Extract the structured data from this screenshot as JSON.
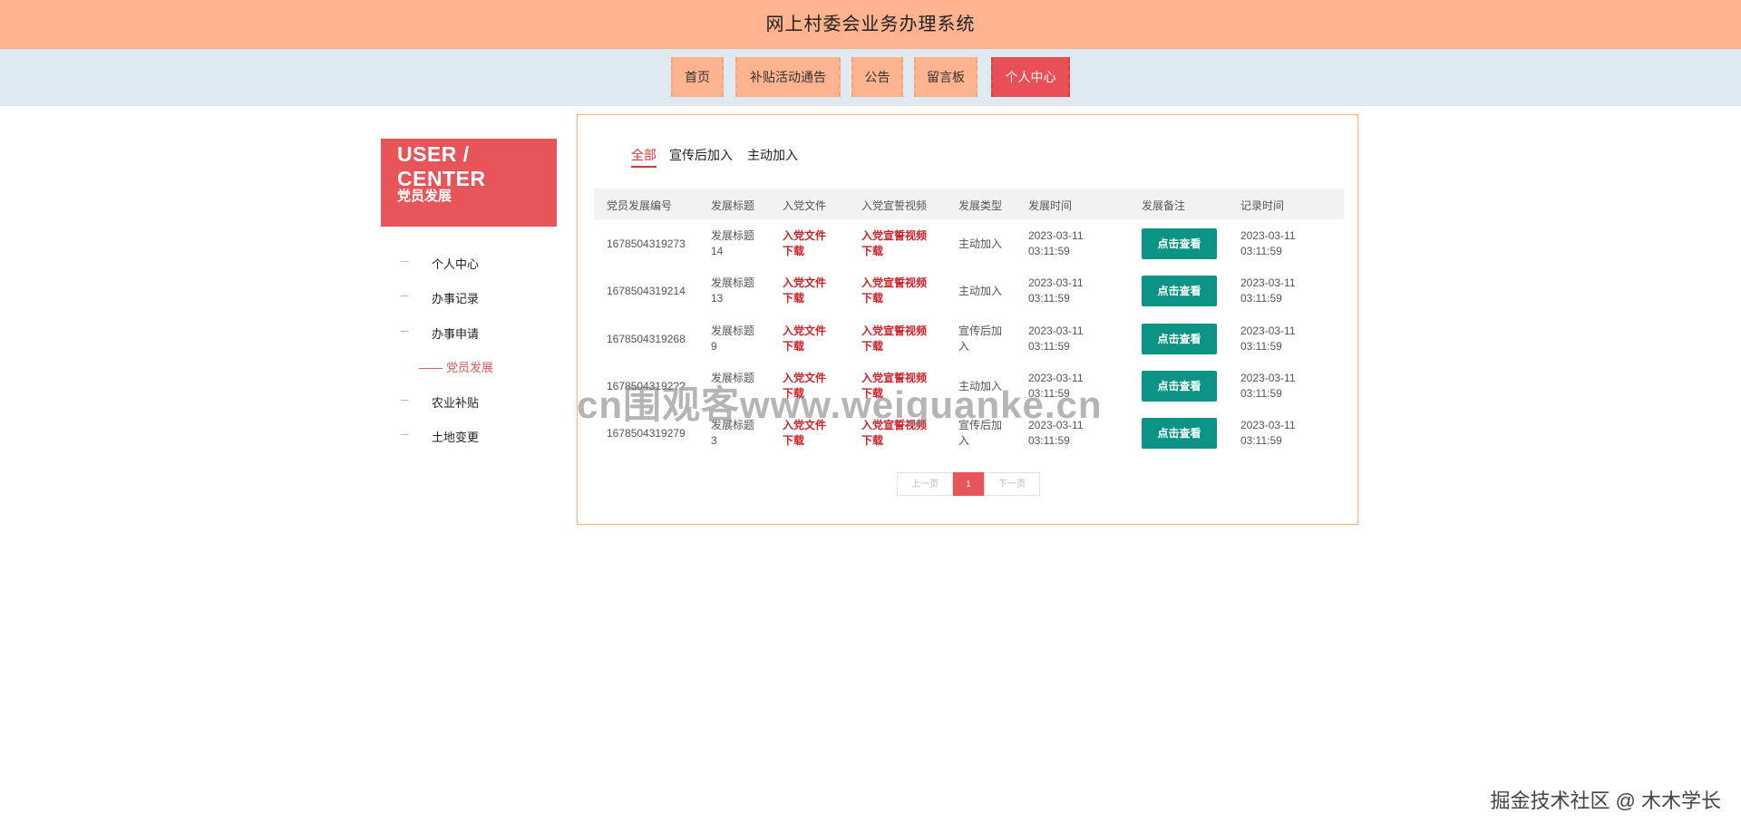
{
  "header": {
    "title": "网上村委会业务办理系统"
  },
  "nav": {
    "items": [
      {
        "label": "首页"
      },
      {
        "label": "补贴活动通告"
      },
      {
        "label": "公告"
      },
      {
        "label": "留言板"
      },
      {
        "label": "个人中心",
        "active": true
      }
    ]
  },
  "sidebar": {
    "card_title": "USER / CENTER",
    "card_subtitle": "党员发展",
    "items": [
      {
        "label": "个人中心"
      },
      {
        "label": "办事记录"
      },
      {
        "label": "办事申请"
      },
      {
        "label": "党员发展",
        "active": true,
        "sub": true
      },
      {
        "label": "农业补贴"
      },
      {
        "label": "土地变更"
      }
    ]
  },
  "filters": [
    {
      "label": "全部",
      "active": true
    },
    {
      "label": "宣传后加入"
    },
    {
      "label": "主动加入"
    }
  ],
  "table": {
    "columns": [
      "党员发展编号",
      "发展标题",
      "入党文件",
      "入党宣誓视频",
      "发展类型",
      "发展时间",
      "发展备注",
      "记录时间"
    ],
    "rows": [
      {
        "id": "1678504319273",
        "title": [
          "发展标题",
          "14"
        ],
        "file": [
          "入党文件",
          "下载"
        ],
        "video": [
          "入党宣誓视频",
          "下载"
        ],
        "type": [
          "主动加入"
        ],
        "dev_time": [
          "2023-03-11",
          "03:11:59"
        ],
        "note": "点击查看",
        "rec_time": [
          "2023-03-11",
          "03:11:59"
        ]
      },
      {
        "id": "1678504319214",
        "title": [
          "发展标题",
          "13"
        ],
        "file": [
          "入党文件",
          "下载"
        ],
        "video": [
          "入党宣誓视频",
          "下载"
        ],
        "type": [
          "主动加入"
        ],
        "dev_time": [
          "2023-03-11",
          "03:11:59"
        ],
        "note": "点击查看",
        "rec_time": [
          "2023-03-11",
          "03:11:59"
        ]
      },
      {
        "id": "1678504319268",
        "title": [
          "发展标题",
          "9"
        ],
        "file": [
          "入党文件",
          "下载"
        ],
        "video": [
          "入党宣誓视频",
          "下载"
        ],
        "type": [
          "宣传后加",
          "入"
        ],
        "dev_time": [
          "2023-03-11",
          "03:11:59"
        ],
        "note": "点击查看",
        "rec_time": [
          "2023-03-11",
          "03:11:59"
        ]
      },
      {
        "id": "16785043192??",
        "title": [
          "发展标题",
          ""
        ],
        "file": [
          "入党文件",
          "下载"
        ],
        "video": [
          "入党宣誓视频",
          "下载"
        ],
        "type": [
          "主动加入"
        ],
        "dev_time": [
          "2023-03-11",
          "03:11:59"
        ],
        "note": "点击查看",
        "rec_time": [
          "2023-03-11",
          "03:11:59"
        ]
      },
      {
        "id": "1678504319279",
        "title": [
          "发展标题",
          "3"
        ],
        "file": [
          "入党文件",
          "下载"
        ],
        "video": [
          "入党宣誓视频",
          "下载"
        ],
        "type": [
          "宣传后加",
          "入"
        ],
        "dev_time": [
          "2023-03-11",
          "03:11:59"
        ],
        "note": "点击查看",
        "rec_time": [
          "2023-03-11",
          "03:11:59"
        ]
      }
    ]
  },
  "pager": {
    "prev": "上一页",
    "current": "1",
    "next": "下一页"
  },
  "watermark": "cn围观客www.weiguanke.cn",
  "footer_mark": "掘金技术社区 @ 木木学长",
  "colors": {
    "header": "#ffb48f",
    "active": "#e85558",
    "button": "#0b9486",
    "link": "#c9242a"
  }
}
